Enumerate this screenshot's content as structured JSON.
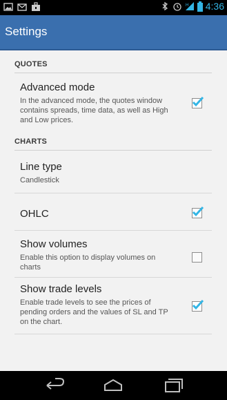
{
  "status_bar": {
    "time": "4:36",
    "left_icons": [
      "image-icon",
      "gmail-icon",
      "briefcase-icon"
    ],
    "right_icons": [
      "bluetooth-icon",
      "alarm-icon",
      "signal-icon",
      "battery-icon"
    ]
  },
  "action_bar": {
    "title": "Settings"
  },
  "sections": {
    "quotes": {
      "header": "QUOTES"
    },
    "charts": {
      "header": "CHARTS"
    }
  },
  "prefs": {
    "advanced_mode": {
      "title": "Advanced mode",
      "summary": "In the advanced mode, the quotes window contains spreads, time data, as well as High and Low prices.",
      "checked": true
    },
    "line_type": {
      "title": "Line type",
      "summary": "Candlestick"
    },
    "ohlc": {
      "title": "OHLC",
      "checked": true
    },
    "show_volumes": {
      "title": "Show volumes",
      "summary": "Enable this option to display volumes on charts",
      "checked": false
    },
    "show_trade_levels": {
      "title": "Show trade levels",
      "summary": "Enable trade levels to see the prices of pending orders and the values of SL and TP on the chart.",
      "checked": true
    }
  },
  "nav_bar": {
    "buttons": [
      "back-icon",
      "home-icon",
      "recents-icon"
    ]
  },
  "colors": {
    "action_bar": "#3a6fae",
    "accent": "#33b5e5",
    "check": "#33b5e5"
  }
}
